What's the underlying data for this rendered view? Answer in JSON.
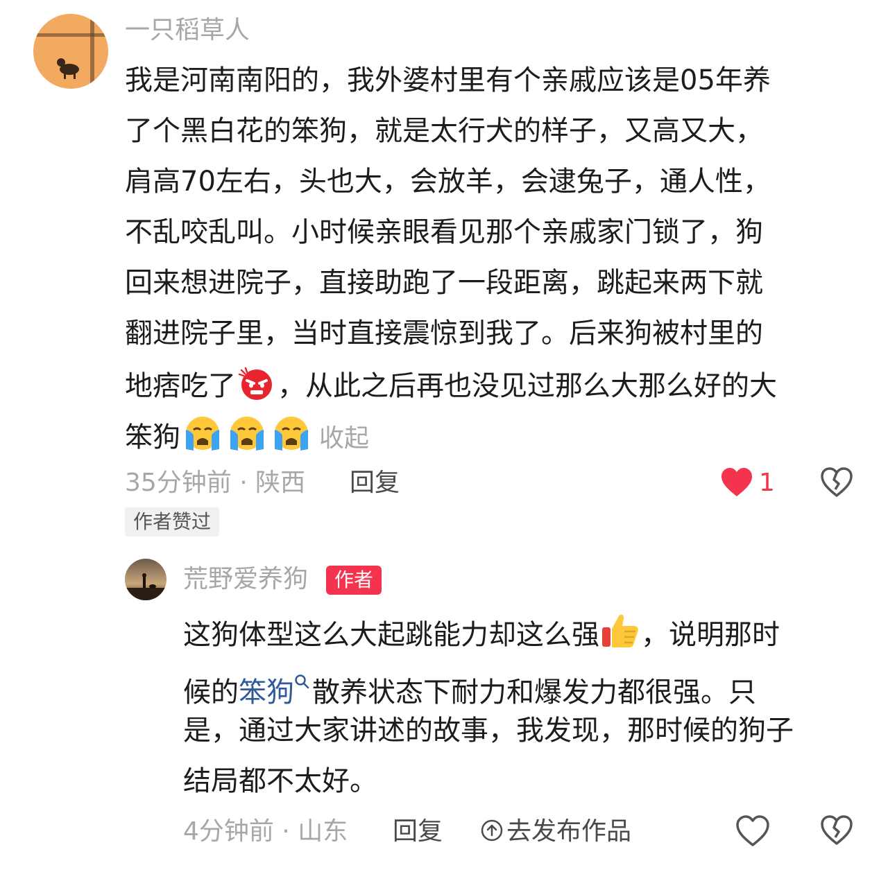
{
  "comment": {
    "username": "一只稻草人",
    "lines": [
      "我是河南南阳的，我外婆村里有个亲戚应该是05年养",
      "了个黑白花的笨狗，就是太行犬的样子，又高又大，",
      "肩高70左右，头也大，会放羊，会逮兔子，通人性，",
      "不乱咬乱叫。小时候亲眼看见那个亲戚家门锁了，狗",
      "回来想进院子，直接助跑了一段距离，跳起来两下就",
      "翻进院子里，当时直接震惊到我了。后来狗被村里的"
    ],
    "line7_a": "地痞吃了",
    "line7_b": "，从此之后再也没见过那么大那么好的大",
    "line8_a": "笨狗",
    "collapse_label": "收起",
    "meta": "35分钟前 · 陕西",
    "reply_label": "回复",
    "like_count": "1",
    "liked": true,
    "author_liked_badge": "作者赞过"
  },
  "reply": {
    "username": "荒野爱养狗",
    "author_badge": "作者",
    "line1_a": "这狗体型这么大起跳能力却这么强",
    "line1_b": "，说明那时",
    "line2_a": "候的",
    "line2_link": "笨狗",
    "line2_b": "散养状态下耐力和爆发力都很强。只",
    "line3": "是，通过大家讲述的故事，我发现，那时候的狗子",
    "line4": "结局都不太好。",
    "meta": "4分钟前 · 山东",
    "reply_label": "回复",
    "publish_label": "去发布作品"
  },
  "icons": {
    "like": "heart-icon",
    "dislike": "broken-heart-icon",
    "angry": "angry-face-emoji",
    "crying": "loudly-crying-face-emoji",
    "thumbs_up": "thumbs-up-emoji",
    "search": "search-icon",
    "upload": "arrow-up-circle-icon"
  },
  "colors": {
    "accent": "#f4334f",
    "muted": "#a7a7a7",
    "link": "#2f5a9a"
  }
}
